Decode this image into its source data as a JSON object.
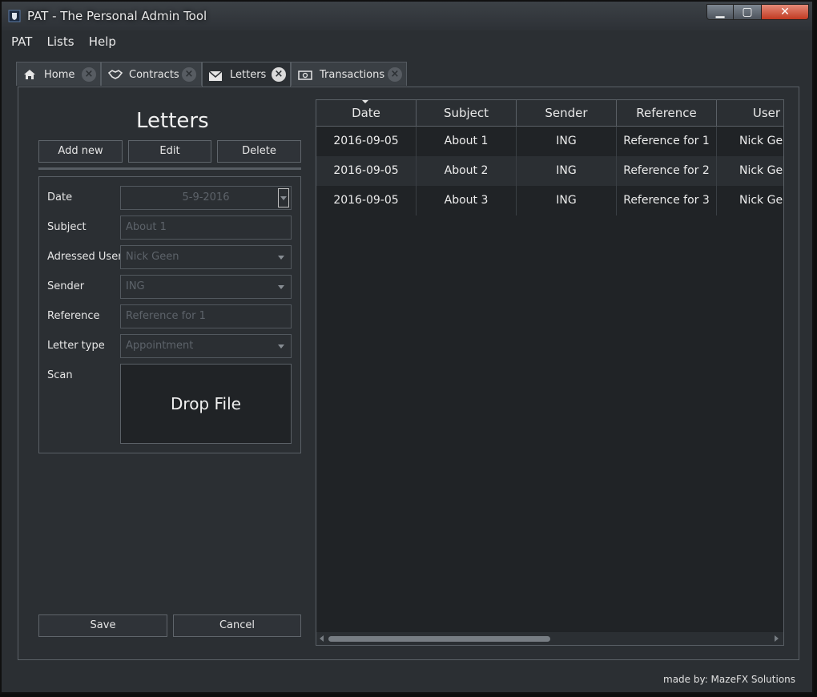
{
  "window": {
    "title": "PAT - The Personal Admin Tool"
  },
  "menu": [
    "PAT",
    "Lists",
    "Help"
  ],
  "tabs": [
    {
      "label": "Home",
      "icon": "home-icon"
    },
    {
      "label": "Contracts",
      "icon": "handshake-icon"
    },
    {
      "label": "Letters",
      "icon": "envelope-icon",
      "active": true
    },
    {
      "label": "Transactions",
      "icon": "money-icon"
    }
  ],
  "panel": {
    "title": "Letters",
    "add_label": "Add new",
    "edit_label": "Edit",
    "delete_label": "Delete",
    "save_label": "Save",
    "cancel_label": "Cancel"
  },
  "form": {
    "date": {
      "label": "Date",
      "value": "5-9-2016"
    },
    "subject": {
      "label": "Subject",
      "value": "About 1"
    },
    "user": {
      "label": "Adressed User",
      "value": "Nick Geen"
    },
    "sender": {
      "label": "Sender",
      "value": "ING"
    },
    "reference": {
      "label": "Reference",
      "value": "Reference for 1"
    },
    "letter_type": {
      "label": "Letter type",
      "value": "Appointment"
    },
    "scan": {
      "label": "Scan",
      "drop_text": "Drop File"
    }
  },
  "table": {
    "columns": [
      "Date",
      "Subject",
      "Sender",
      "Reference",
      "User"
    ],
    "rows": [
      [
        "2016-09-05",
        "About 1",
        "ING",
        "Reference for 1",
        "Nick Geen"
      ],
      [
        "2016-09-05",
        "About 2",
        "ING",
        "Reference for 2",
        "Nick Geen"
      ],
      [
        "2016-09-05",
        "About 3",
        "ING",
        "Reference for 3",
        "Nick Geen"
      ]
    ]
  },
  "footer": "made by: MazeFX Solutions",
  "colors": {
    "background": "#2b2f33",
    "panel_dark": "#202326",
    "border": "#5a6066",
    "close_button": "#c23a22"
  }
}
